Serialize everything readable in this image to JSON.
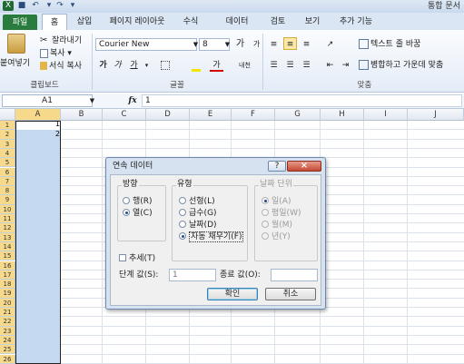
{
  "window": {
    "title": "통합 문서"
  },
  "tabs": {
    "file": "파일",
    "home": "홈",
    "insert": "삽입",
    "page_layout": "페이지 레이아웃",
    "formulas": "수식",
    "data": "데이터",
    "review": "검토",
    "view": "보기",
    "addins": "추가 기능"
  },
  "clipboard": {
    "paste": "붙여넣기",
    "cut": "잘라내기",
    "copy": "복사",
    "format_painter": "서식 복사",
    "group_label": "클립보드"
  },
  "font": {
    "name": "Courier New",
    "size": "8",
    "grow": "가",
    "shrink": "가",
    "bold": "가",
    "italic": "가",
    "underline": "가",
    "color": "가",
    "phonetic": "내천",
    "group_label": "글꼴"
  },
  "alignment": {
    "wrap_text": "텍스트 줄 바꿈",
    "merge_center": "병합하고 가운데 맞춤",
    "group_label": "맞춤"
  },
  "formula_bar": {
    "name_box": "A1",
    "fx": "fx",
    "value": "1"
  },
  "grid": {
    "columns": [
      "A",
      "B",
      "C",
      "D",
      "E",
      "F",
      "G",
      "H",
      "I",
      "J"
    ],
    "rows": [
      "1",
      "2",
      "3",
      "4",
      "5",
      "6",
      "7",
      "8",
      "9",
      "10",
      "11",
      "12",
      "13",
      "14",
      "15",
      "16",
      "17",
      "18",
      "19",
      "20",
      "21",
      "22",
      "23",
      "24",
      "25",
      "26"
    ],
    "cells": {
      "A1": "1",
      "A2": "2"
    }
  },
  "dialog": {
    "title": "연속 데이터",
    "help_icon": "?",
    "close_icon": "×",
    "series_in": {
      "label": "방향",
      "rows": "행(R)",
      "columns": "열(C)",
      "selected": "열(C)"
    },
    "type": {
      "label": "유형",
      "linear": "선형(L)",
      "growth": "급수(G)",
      "date": "날짜(D)",
      "autofill": "자동 채우기(F)",
      "selected": "자동 채우기(F)"
    },
    "date_unit": {
      "label": "날짜 단위",
      "day": "일(A)",
      "weekday": "평일(W)",
      "month": "월(M)",
      "year": "년(Y)"
    },
    "trend": "추세(T)",
    "step_label": "단계 값(S):",
    "step_value": "1",
    "stop_label": "종료 값(O):",
    "stop_value": "",
    "ok": "확인",
    "cancel": "취소"
  }
}
